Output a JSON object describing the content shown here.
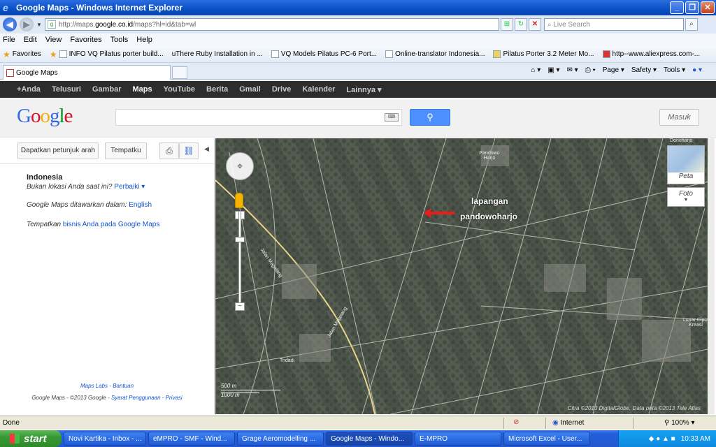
{
  "window": {
    "title": "Google Maps - Windows Internet Explorer",
    "address": {
      "prefix": "http://maps.",
      "host": "google.co.id",
      "path": "/maps?hl=id&tab=wl"
    },
    "search_placeholder": "Live Search"
  },
  "menu": [
    "File",
    "Edit",
    "View",
    "Favorites",
    "Tools",
    "Help"
  ],
  "favorites": {
    "label": "Favorites",
    "items": [
      "INFO VQ Pilatus porter build...",
      "uThere Ruby Installation in ...",
      "VQ Models Pilatus PC-6 Port...",
      "Online-translator Indonesia...",
      "Pilatus Porter 3.2 Meter Mo...",
      "http--www.aliexpress.com-..."
    ]
  },
  "tab": {
    "label": "Google Maps"
  },
  "commandbar": [
    "Page ▾",
    "Safety ▾",
    "Tools ▾"
  ],
  "gbar": [
    "+Anda",
    "Telusuri",
    "Gambar",
    "Maps",
    "YouTube",
    "Berita",
    "Gmail",
    "Drive",
    "Kalender",
    "Lainnya ▾"
  ],
  "gbar_active": "Maps",
  "header": {
    "signin": "Masuk"
  },
  "left": {
    "directions_btn": "Dapatkan petunjuk arah",
    "place_btn": "Tempatku",
    "country": "Indonesia",
    "not_location": "Bukan lokasi Anda saat ini?",
    "fix_link": "Perbaiki ▾",
    "offered": "Google Maps ditawarkan dalam:",
    "lang_link": "English",
    "place_text": "Tempatkan",
    "business_link": "bisnis Anda pada Google Maps",
    "footer_line1": "Maps Labs - Bantuan",
    "footer_line2_a": "Google Maps - ©2013 Google - ",
    "footer_line2_b": "Syarat Penggunaan - Privasi"
  },
  "map": {
    "type_map": "Peta",
    "type_photo": "Foto",
    "annotation1": "lapangan",
    "annotation2": "pandowoharjo",
    "places": {
      "p1": "Pandowo Harjo",
      "p2": "Lunar Cipta Kreasi",
      "p3": "Tridadi",
      "p4": "Donoharjo",
      "road1": "Jalan Magelang",
      "road2": "Jalan Magelang"
    },
    "scale_m": "500 m",
    "scale_ft": "1000 m",
    "copyright": "Citra ©2013 DigitalGlobe, Data peta ©2013 Tele Atlas"
  },
  "statusbar": {
    "left": "Done",
    "zone": "Internet",
    "zoom": "100% ▾"
  },
  "taskbar": {
    "start": "start",
    "tasks": [
      "Novi Kartika - Inbox - ...",
      "eMPRO - SMF - Wind...",
      "Grage Aeromodelling ...",
      "Google Maps - Windo...",
      "E-MPRO",
      "Microsoft Excel - User..."
    ],
    "active_index": 3,
    "time": "10:33 AM"
  }
}
